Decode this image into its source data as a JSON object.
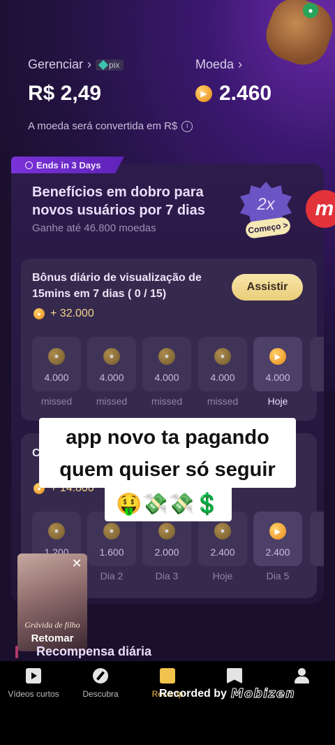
{
  "header": {
    "manage_label": "Gerenciar",
    "pix_label": "pix",
    "balance": "R$ 2,49",
    "coin_label": "Moeda",
    "coin_balance": "2.460",
    "conversion_note": "A moeda será convertida em R$"
  },
  "promo": {
    "ends_tag": "Ends in  3 Days",
    "title": "Benefícios em dobro para novos usuários por 7 dias",
    "subtitle": "Ganhe até 46.800 moedas",
    "badge": "2x",
    "start_button": "Começo >",
    "brand_letter": "m"
  },
  "daily_watch": {
    "title": "Bônus diário de visualização de 15mins em 7 dias ( 0 / 15)",
    "reward": "+ 32.000",
    "watch_button": "Assistir",
    "days": [
      {
        "amount": "4.000",
        "label": "missed"
      },
      {
        "amount": "4.000",
        "label": "missed"
      },
      {
        "amount": "4.000",
        "label": "missed"
      },
      {
        "amount": "4.000",
        "label": "missed"
      },
      {
        "amount": "4.000",
        "label": "Hoje"
      }
    ]
  },
  "daily_checkin": {
    "title_initial": "C",
    "reward": "+ 14.800",
    "days": [
      {
        "amount": "1.200",
        "label": ""
      },
      {
        "amount": "1.600",
        "label": "Dia 2"
      },
      {
        "amount": "2.000",
        "label": "Dia 3"
      },
      {
        "amount": "2.400",
        "label": "Hoje"
      },
      {
        "amount": "2.400",
        "label": "Dia 5"
      }
    ]
  },
  "overlay_caption": {
    "line1": "app novo ta pagando",
    "line2": "quem quiser só seguir",
    "emoji": "🤑💸💸💲"
  },
  "mini_player": {
    "art_title": "Grávida de filho",
    "resume_label": "Retomar"
  },
  "section_title": "Recompensa diária",
  "bottom_nav": {
    "items": [
      {
        "label": "Vídeos curtos",
        "icon": "play-icon"
      },
      {
        "label": "Descubra",
        "icon": "compass-icon"
      },
      {
        "label": "Recomp",
        "icon": "gift-icon"
      },
      {
        "label": "",
        "icon": "bookmark-icon"
      },
      {
        "label": "",
        "icon": "user-icon"
      }
    ]
  },
  "watermark": {
    "text": "Recorded by",
    "logo": "Mobizen"
  },
  "colors": {
    "accent_gold": "#f1c24c",
    "card_bg": "#35294d",
    "tag_purple": "#7a33d8",
    "brand_red": "#e2323a"
  }
}
